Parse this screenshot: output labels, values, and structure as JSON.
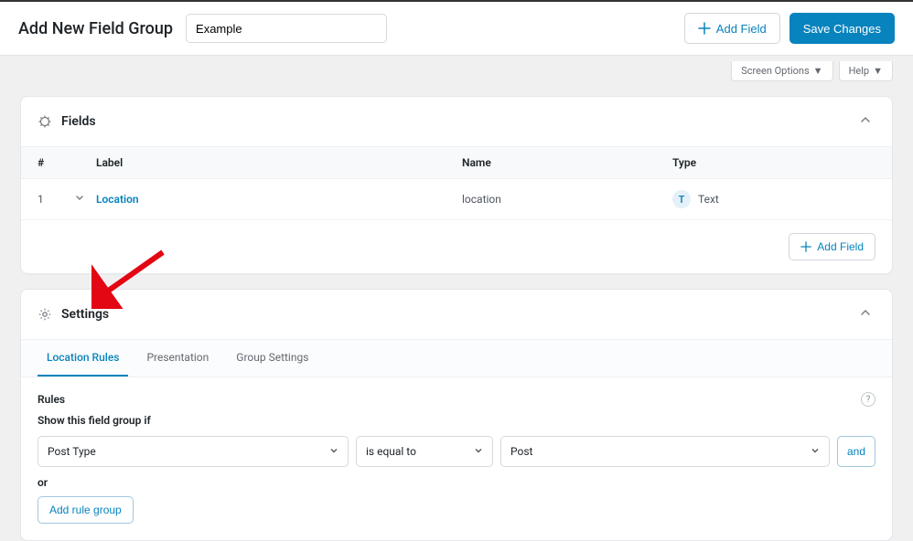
{
  "header": {
    "page_title": "Add New Field Group",
    "title_value": "Example",
    "add_field": "Add Field",
    "save_changes": "Save Changes"
  },
  "screen_tabs": {
    "screen_options": "Screen Options",
    "help": "Help"
  },
  "fields_panel": {
    "title": "Fields",
    "columns": {
      "num": "#",
      "label": "Label",
      "name": "Name",
      "type": "Type"
    },
    "rows": [
      {
        "num": "1",
        "label": "Location",
        "name": "location",
        "type_glyph": "T",
        "type_text": "Text"
      }
    ],
    "add_field": "Add Field"
  },
  "settings_panel": {
    "title": "Settings",
    "tabs": {
      "location_rules": "Location Rules",
      "presentation": "Presentation",
      "group_settings": "Group Settings"
    },
    "rules_heading": "Rules",
    "rules_sub": "Show this field group if",
    "rule": {
      "param": "Post Type",
      "operator": "is equal to",
      "value": "Post",
      "and": "and"
    },
    "or": "or",
    "add_rule_group": "Add rule group"
  }
}
